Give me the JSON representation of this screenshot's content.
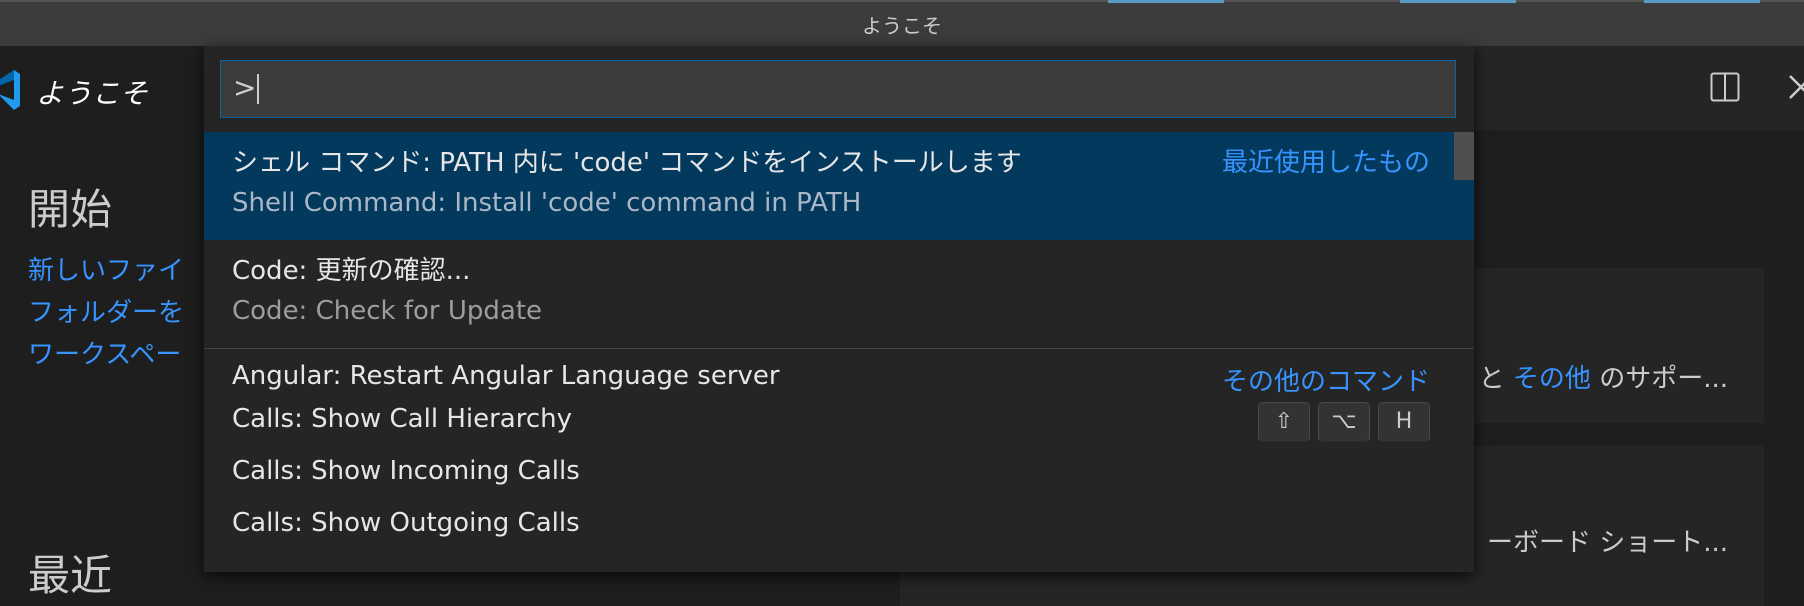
{
  "window": {
    "title": "ようこそ"
  },
  "tab": {
    "label": "ようこそ",
    "logo_icon": "vscode-logo-icon",
    "split_icon": "split-editor-icon",
    "close_icon": "close-icon"
  },
  "welcome": {
    "start_heading": "開始",
    "start_links": [
      "新しいファイ",
      "フォルダーを",
      "ワークスペー"
    ],
    "recent_heading": "最近",
    "card1": {
      "prefix": "と",
      "link": "その他",
      "suffix": " のサポー..."
    },
    "card2": {
      "text": "ーボード ショート..."
    }
  },
  "palette": {
    "input_value": ">",
    "items": [
      {
        "label": "シェル コマンド: PATH 内に 'code' コマンドをインストールします",
        "detail": "Shell Command: Install 'code' command in PATH",
        "group": "最近使用したもの"
      },
      {
        "label": "Code: 更新の確認...",
        "detail": "Code: Check for Update"
      },
      {
        "label": "Angular: Restart Angular Language server",
        "group": "その他のコマンド"
      },
      {
        "label": "Calls: Show Call Hierarchy",
        "keybinding": [
          "⇧",
          "⌥",
          "H"
        ]
      },
      {
        "label": "Calls: Show Incoming Calls"
      },
      {
        "label": "Calls: Show Outgoing Calls"
      }
    ]
  },
  "colors": {
    "accent": "#3794ff",
    "selection": "#04395e",
    "background": "#1e1e1e",
    "input_border": "#0e639c"
  }
}
